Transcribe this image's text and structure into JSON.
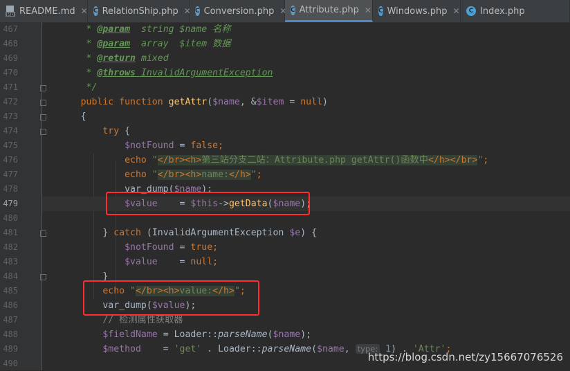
{
  "tabs": [
    {
      "label": "README.md",
      "icon": "markdown-file-icon",
      "active": false
    },
    {
      "label": "RelationShip.php",
      "icon": "php-file-icon",
      "active": false
    },
    {
      "label": "Conversion.php",
      "icon": "php-file-icon",
      "active": false
    },
    {
      "label": "Attribute.php",
      "icon": "php-file-icon",
      "active": true
    },
    {
      "label": "Windows.php",
      "icon": "class-file-icon",
      "active": false
    },
    {
      "label": "Index.php",
      "icon": "class-file-icon",
      "active": false
    }
  ],
  "line_numbers": [
    "467",
    "468",
    "469",
    "470",
    "471",
    "472",
    "473",
    "474",
    "475",
    "476",
    "477",
    "478",
    "479",
    "480",
    "481",
    "482",
    "483",
    "484",
    "485",
    "486",
    "487",
    "488",
    "489",
    "490"
  ],
  "current_line": "479",
  "code": {
    "l467": {
      "star": "* ",
      "tag": "@param",
      "sp": "  ",
      "type": "string ",
      "var": "$name ",
      "desc": "名称"
    },
    "l468": {
      "star": "* ",
      "tag": "@param",
      "sp": "  ",
      "type": "array  ",
      "var": "$item ",
      "desc": "数据"
    },
    "l469": {
      "star": "* ",
      "tag": "@return",
      "type": " mixed"
    },
    "l470": {
      "star": "* ",
      "tag": "@throws",
      "exc": " InvalidArgumentException"
    },
    "l471": {
      "text": "*/"
    },
    "l472": {
      "kw": "public function ",
      "fn": "getAttr",
      "p1": "(",
      "v1": "$name",
      "p2": ", &",
      "v2": "$item",
      "p3": " = ",
      "kw2": "null",
      "p4": ")"
    },
    "l473": {
      "text": "{"
    },
    "l474": {
      "kw": "try ",
      "p": "{"
    },
    "l475": {
      "v": "$notFound",
      "p": " = ",
      "kw": "false",
      "sc": ";"
    },
    "l476": {
      "kw": "echo ",
      "q1": "\"",
      "html1": "</br><h>",
      "txt": "第三站分支二站：Attribute.php getAttr()函数中",
      "html2": "</h></br>",
      "q2": "\"",
      "sc": ";"
    },
    "l477": {
      "kw": "echo ",
      "q1": "\"",
      "html1": "</br><h>",
      "txt": "name:",
      "html2": "</h>",
      "q2": "\"",
      "sc": ";"
    },
    "l478": {
      "fn": "var_dump",
      "p1": "(",
      "v": "$name",
      "p2": ");"
    },
    "l479": {
      "v": "$value",
      "p": "    = ",
      "v2": "$this",
      "arrow": "->",
      "fn": "getData",
      "p1": "(",
      "v3": "$name",
      "p2": ");"
    },
    "l480": {
      "text": ""
    },
    "l481": {
      "p1": "} ",
      "kw": "catch ",
      "p2": "(InvalidArgumentException ",
      "v": "$e",
      "p3": ") {"
    },
    "l482": {
      "v": "$notFound",
      "p": " = ",
      "kw": "true",
      "sc": ";"
    },
    "l483": {
      "v": "$value",
      "p": "    = ",
      "kw": "null",
      "sc": ";"
    },
    "l484": {
      "text": "}"
    },
    "l485": {
      "kw": "echo ",
      "q1": "\"",
      "html1": "</br><h>",
      "txt": "value:",
      "html2": "</h>",
      "q2": "\"",
      "sc": ";"
    },
    "l486": {
      "fn": "var_dump",
      "p1": "(",
      "v": "$value",
      "p2": ");"
    },
    "l487": {
      "text": "// 检测属性获取器"
    },
    "l488": {
      "v": "$fieldName",
      "p": " = Loader::",
      "fn": "parseName",
      "p1": "(",
      "v2": "$name",
      "p2": ");"
    },
    "l489": {
      "v": "$method",
      "p": "    = ",
      "s": "'get'",
      "p1": " . Loader::",
      "fn": "parseName",
      "p2": "(",
      "v2": "$name",
      "p3": ", ",
      "hint": "type:",
      "num": " 1",
      "p4": ") . ",
      "s2": "'Attr'",
      "sc": ";"
    }
  },
  "watermark": "https://blog.csdn.net/zy15667076526",
  "colors": {
    "highlight_box": "#ff2d2d",
    "keyword": "#cc7832",
    "variable": "#9876aa",
    "string": "#6a8759",
    "function": "#ffc66d"
  }
}
